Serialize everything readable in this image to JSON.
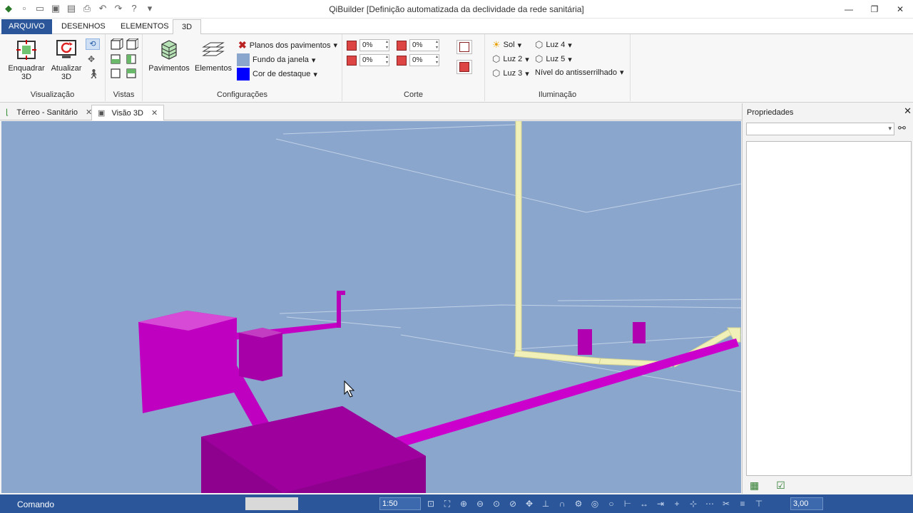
{
  "window": {
    "title": "QiBuilder [Definição automatizada da declividade da rede sanitária]",
    "min": "—",
    "max": "❐",
    "close": "✕"
  },
  "tabs": {
    "file": "ARQUIVO",
    "drawings": "DESENHOS",
    "elements": "ELEMENTOS",
    "view3d": "3D"
  },
  "ribbon": {
    "visualizacao": {
      "frame_line1": "Enquadrar",
      "frame_line2": "3D",
      "update_line1": "Atualizar",
      "update_line2": "3D",
      "label": "Visualização"
    },
    "vistas": {
      "label": "Vistas"
    },
    "configuracoes": {
      "pavimentos": "Pavimentos",
      "elementos": "Elementos",
      "planos": "Planos dos pavimentos",
      "fundo": "Fundo da janela",
      "destaque": "Cor de destaque",
      "fundo_color": "#8aa6cc",
      "destaque_color": "#0000ff",
      "label": "Configurações"
    },
    "corte": {
      "v1": "0%",
      "v2": "0%",
      "v3": "0%",
      "v4": "0%",
      "label": "Corte"
    },
    "iluminacao": {
      "sol": "Sol",
      "luz2": "Luz 2",
      "luz3": "Luz 3",
      "luz4": "Luz 4",
      "luz5": "Luz 5",
      "antisserrilhado": "Nível do antisserrilhado",
      "label": "Iluminação"
    }
  },
  "doc_tabs": [
    {
      "label": "Térreo - Sanitário"
    },
    {
      "label": "Visão 3D"
    }
  ],
  "properties": {
    "title": "Propriedades"
  },
  "status": {
    "command": "Comando",
    "scale": "1:50",
    "value": "3,00"
  }
}
